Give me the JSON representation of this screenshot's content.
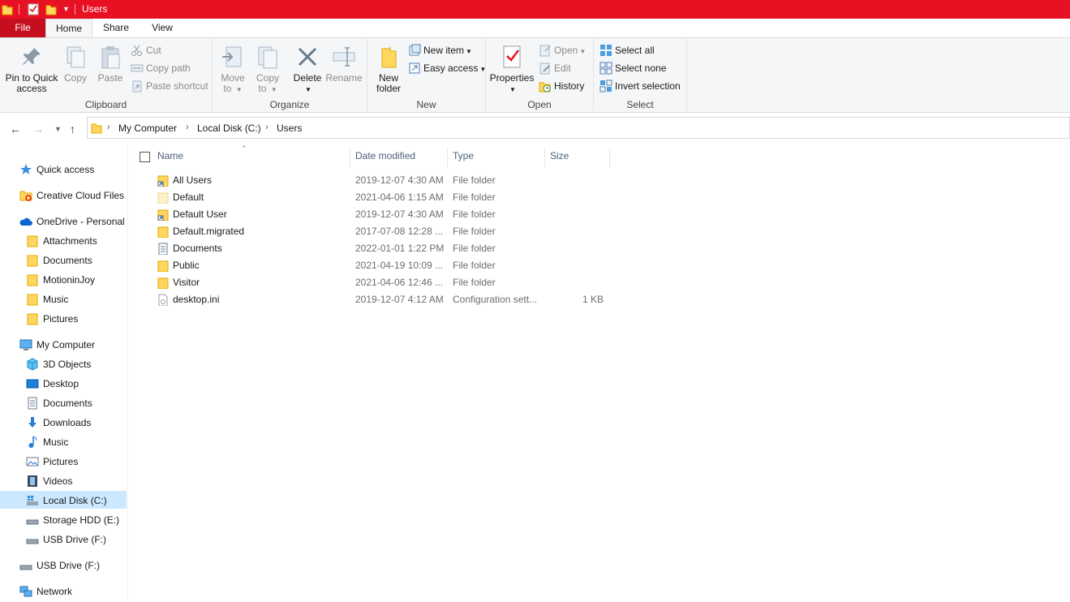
{
  "window": {
    "title": "Users"
  },
  "ribbon_tabs": [
    "File",
    "Home",
    "Share",
    "View"
  ],
  "clipboard": {
    "label": "Clipboard",
    "pin_label_1": "Pin to Quick",
    "pin_label_2": "access",
    "copy": "Copy",
    "paste": "Paste",
    "cut": "Cut",
    "copy_path": "Copy path",
    "paste_shortcut": "Paste shortcut"
  },
  "organize": {
    "label": "Organize",
    "move_1": "Move",
    "move_2": "to",
    "copyto_1": "Copy",
    "copyto_2": "to",
    "delete": "Delete",
    "rename": "Rename"
  },
  "new_group": {
    "label": "New",
    "new_folder_1": "New",
    "new_folder_2": "folder",
    "new_item": "New item",
    "easy_access": "Easy access"
  },
  "open_group": {
    "label": "Open",
    "properties": "Properties",
    "open": "Open",
    "edit": "Edit",
    "history": "History"
  },
  "select_group": {
    "label": "Select",
    "select_all": "Select all",
    "select_none": "Select none",
    "invert": "Invert selection"
  },
  "address": {
    "crumbs": [
      "My Computer",
      "Local Disk (C:)",
      "Users"
    ]
  },
  "nav": {
    "quick_access": "Quick access",
    "creative_cloud": "Creative Cloud Files",
    "onedrive": "OneDrive - Personal",
    "onedrive_items": [
      "Attachments",
      "Documents",
      "MotioninJoy",
      "Music",
      "Pictures"
    ],
    "my_computer": "My Computer",
    "computer_items": [
      "3D Objects",
      "Desktop",
      "Documents",
      "Downloads",
      "Music",
      "Pictures",
      "Videos",
      "Local Disk (C:)",
      "Storage HDD (E:)",
      "USB Drive (F:)"
    ],
    "usb_drive": "USB Drive (F:)",
    "network": "Network"
  },
  "columns": {
    "name": "Name",
    "date": "Date modified",
    "type": "Type",
    "size": "Size"
  },
  "files": [
    {
      "name": "All Users",
      "date": "2019-12-07 4:30 AM",
      "type": "File folder",
      "size": "",
      "icon": "folder-shortcut"
    },
    {
      "name": "Default",
      "date": "2021-04-06 1:15 AM",
      "type": "File folder",
      "size": "",
      "icon": "folder-hidden"
    },
    {
      "name": "Default User",
      "date": "2019-12-07 4:30 AM",
      "type": "File folder",
      "size": "",
      "icon": "folder-shortcut"
    },
    {
      "name": "Default.migrated",
      "date": "2017-07-08 12:28 ...",
      "type": "File folder",
      "size": "",
      "icon": "folder"
    },
    {
      "name": "Documents",
      "date": "2022-01-01 1:22 PM",
      "type": "File folder",
      "size": "",
      "icon": "documents"
    },
    {
      "name": "Public",
      "date": "2021-04-19 10:09 ...",
      "type": "File folder",
      "size": "",
      "icon": "folder"
    },
    {
      "name": "Visitor",
      "date": "2021-04-06 12:46 ...",
      "type": "File folder",
      "size": "",
      "icon": "folder"
    },
    {
      "name": "desktop.ini",
      "date": "2019-12-07 4:12 AM",
      "type": "Configuration sett...",
      "size": "1 KB",
      "icon": "ini-file"
    }
  ],
  "colors": {
    "titlebar": "#e81123",
    "file_tab": "#c50f1f",
    "selection": "#cce8ff",
    "folder": "#ffd75e"
  }
}
